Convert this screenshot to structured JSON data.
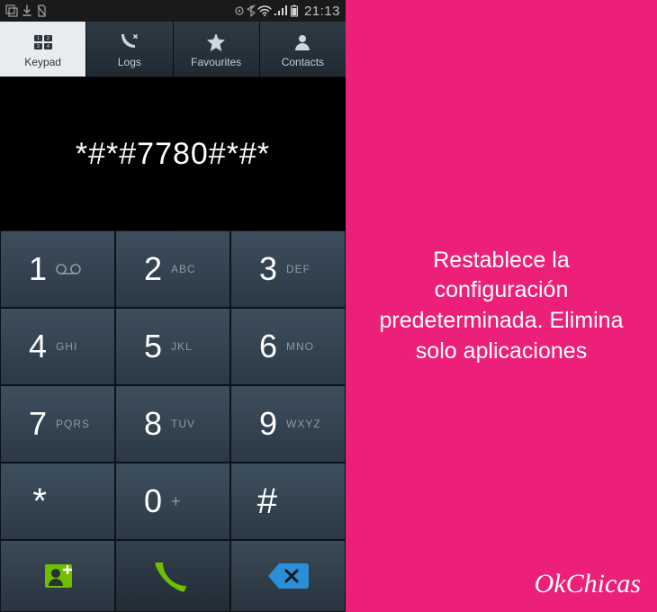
{
  "colors": {
    "accent_pink": "#ec2079",
    "call_green": "#6fbf00",
    "delete_icon": "#2a8fd6",
    "keypad_bg_top": "#3d4e5c",
    "keypad_bg_bottom": "#2b3946"
  },
  "statusbar": {
    "clock": "21:13",
    "left_icons": [
      "screenshot-icon",
      "download-icon",
      "sim-no-icon"
    ],
    "right_icons": [
      "gps-icon",
      "bluetooth-icon",
      "wifi-icon",
      "signal-icon",
      "battery-icon"
    ]
  },
  "tabs": [
    {
      "label": "Keypad",
      "icon": "keypad-icon",
      "active": true
    },
    {
      "label": "Logs",
      "icon": "logs-icon",
      "active": false
    },
    {
      "label": "Favourites",
      "icon": "star-icon",
      "active": false
    },
    {
      "label": "Contacts",
      "icon": "contacts-icon",
      "active": false
    }
  ],
  "dialed": "*#*#7780#*#*",
  "keypad": [
    {
      "digit": "1",
      "sub": "",
      "sub_type": "voicemail"
    },
    {
      "digit": "2",
      "sub": "ABC",
      "sub_type": "letters"
    },
    {
      "digit": "3",
      "sub": "DEF",
      "sub_type": "letters"
    },
    {
      "digit": "4",
      "sub": "GHI",
      "sub_type": "letters"
    },
    {
      "digit": "5",
      "sub": "JKL",
      "sub_type": "letters"
    },
    {
      "digit": "6",
      "sub": "MNO",
      "sub_type": "letters"
    },
    {
      "digit": "7",
      "sub": "PQRS",
      "sub_type": "letters"
    },
    {
      "digit": "8",
      "sub": "TUV",
      "sub_type": "letters"
    },
    {
      "digit": "9",
      "sub": "WXYZ",
      "sub_type": "letters"
    },
    {
      "digit": "*",
      "sub": "",
      "sub_type": "none"
    },
    {
      "digit": "0",
      "sub": "+",
      "sub_type": "plus"
    },
    {
      "digit": "#",
      "sub": "",
      "sub_type": "none"
    }
  ],
  "actions": {
    "add_contact": "add-contact-button",
    "call": "call-button",
    "backspace": "backspace-button"
  },
  "panel": {
    "description": "Restablece la configuración predeterminada. Elimina solo aplicaciones",
    "brand": "OkChicas"
  }
}
